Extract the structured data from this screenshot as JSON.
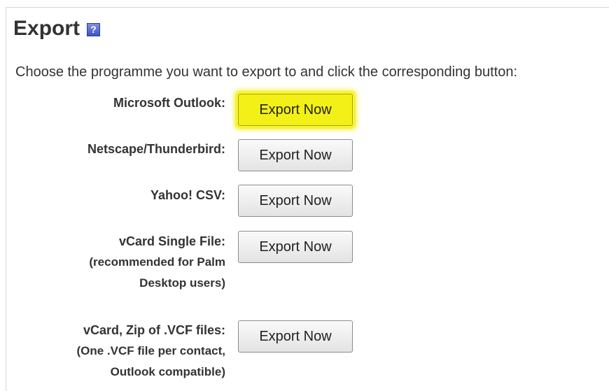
{
  "header": {
    "title": "Export",
    "help_icon": "help-icon",
    "help_glyph": "?"
  },
  "instruction": "Choose the programme you want to export to and click the corresponding button:",
  "options": [
    {
      "label": "Microsoft Outlook:",
      "note": "",
      "button_label": "Export Now",
      "highlighted": true
    },
    {
      "label": "Netscape/Thunderbird:",
      "note": "",
      "button_label": "Export Now",
      "highlighted": false
    },
    {
      "label": "Yahoo! CSV:",
      "note": "",
      "button_label": "Export Now",
      "highlighted": false
    },
    {
      "label": "vCard Single File:",
      "note_line1": "(recommended for Palm",
      "note_line2": "Desktop users)",
      "button_label": "Export Now",
      "highlighted": false
    },
    {
      "label": "vCard, Zip of .VCF files:",
      "note_line1": "(One .VCF file per contact,",
      "note_line2": "Outlook compatible)",
      "button_label": "Export Now",
      "highlighted": false
    }
  ],
  "colors": {
    "highlight": "#f3f017",
    "text": "#333333",
    "help_icon": "#3f53c2"
  }
}
